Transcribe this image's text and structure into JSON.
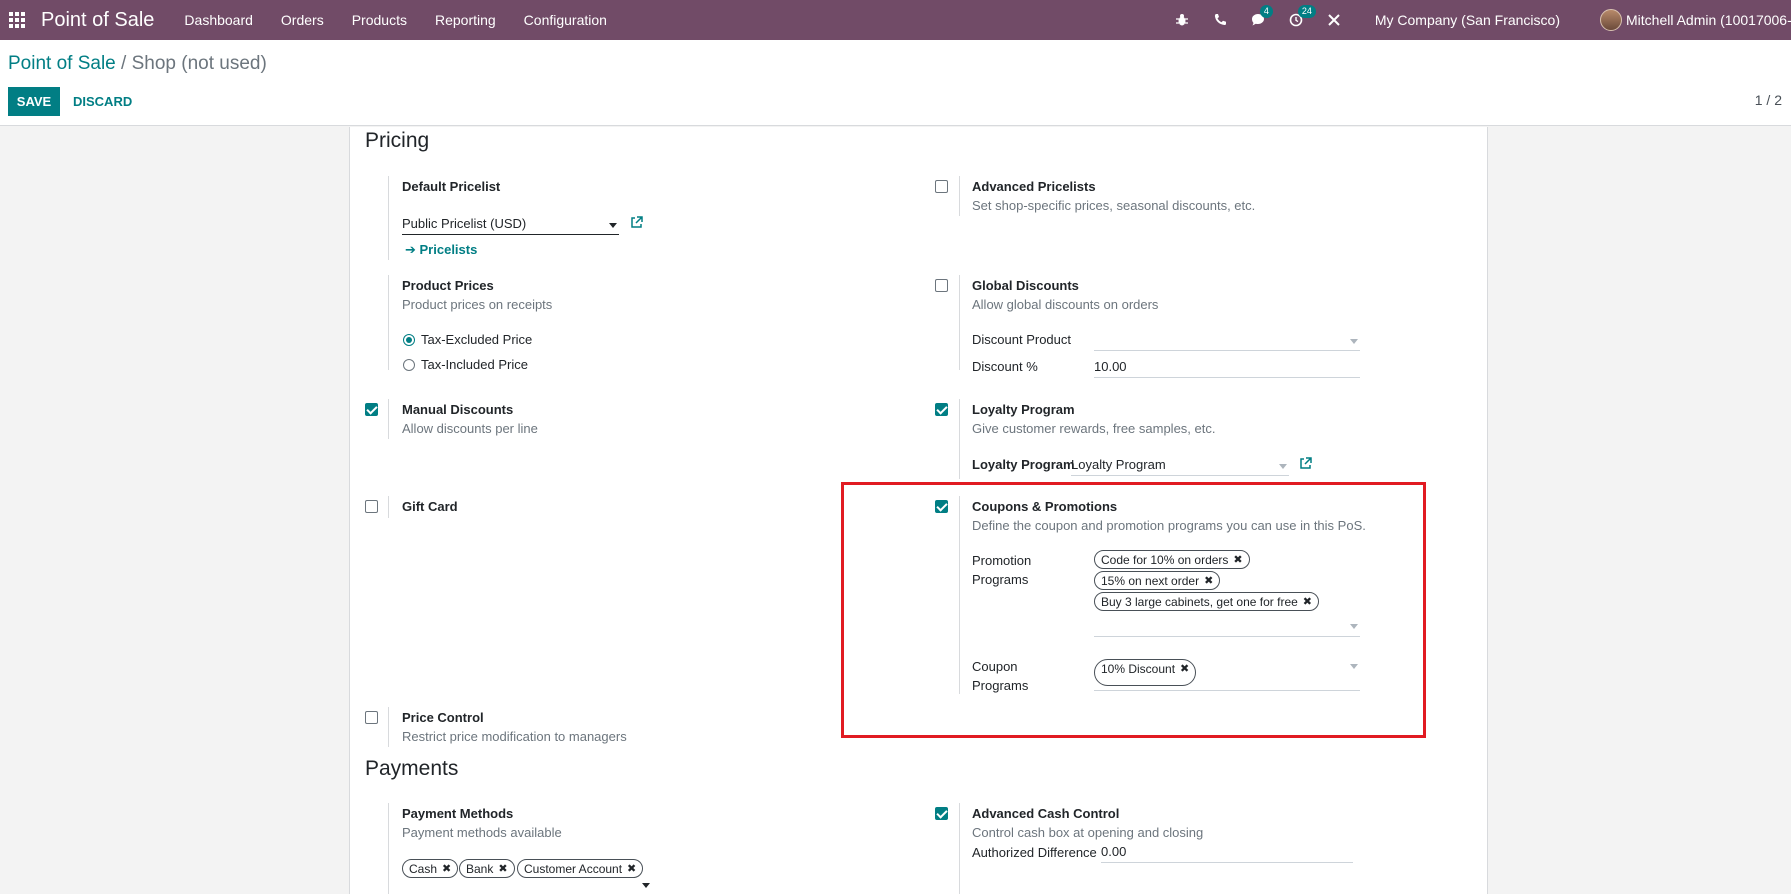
{
  "navbar": {
    "brand": "Point of Sale",
    "menu": [
      "Dashboard",
      "Orders",
      "Products",
      "Reporting",
      "Configuration"
    ],
    "messages_count": "4",
    "activities_count": "24",
    "company": "My Company (San Francisco)",
    "user": "Mitchell Admin (10017006-m"
  },
  "breadcrumb": {
    "parent": "Point of Sale",
    "separator": " / ",
    "current": "Shop (not used)"
  },
  "actions": {
    "save": "SAVE",
    "discard": "DISCARD"
  },
  "pager": "1 / 2",
  "pricing": {
    "title": "Pricing",
    "default_pricelist": {
      "title": "Default Pricelist",
      "value": "Public Pricelist (USD)",
      "link": "Pricelists"
    },
    "advanced_pricelists": {
      "title": "Advanced Pricelists",
      "desc": "Set shop-specific prices, seasonal discounts, etc.",
      "checked": false
    },
    "product_prices": {
      "title": "Product Prices",
      "desc": "Product prices on receipts",
      "options": [
        "Tax-Excluded Price",
        "Tax-Included Price"
      ],
      "selected": "Tax-Excluded Price"
    },
    "global_discounts": {
      "title": "Global Discounts",
      "desc": "Allow global discounts on orders",
      "checked": false,
      "discount_product_label": "Discount Product",
      "discount_product_value": "",
      "discount_pct_label": "Discount %",
      "discount_pct_value": "10.00"
    },
    "manual_discounts": {
      "title": "Manual Discounts",
      "desc": "Allow discounts per line",
      "checked": true
    },
    "loyalty_program": {
      "title": "Loyalty Program",
      "desc": "Give customer rewards, free samples, etc.",
      "checked": true,
      "field_label": "Loyalty Program",
      "field_value": "Loyalty Program"
    },
    "gift_card": {
      "title": "Gift Card",
      "checked": false
    },
    "coupons": {
      "title": "Coupons & Promotions",
      "desc": "Define the coupon and promotion programs you can use in this PoS.",
      "checked": true,
      "promotion_label_1": "Promotion",
      "promotion_label_2": "Programs",
      "promotion_tags": [
        "Code for 10% on orders",
        "15% on next order",
        "Buy 3 large cabinets, get one for free"
      ],
      "coupon_label_1": "Coupon",
      "coupon_label_2": "Programs",
      "coupon_tags": [
        "10% Discount"
      ]
    },
    "price_control": {
      "title": "Price Control",
      "desc": "Restrict price modification to managers",
      "checked": false
    }
  },
  "payments": {
    "title": "Payments",
    "payment_methods": {
      "title": "Payment Methods",
      "desc": "Payment methods available",
      "tags": [
        "Cash",
        "Bank",
        "Customer Account"
      ]
    },
    "cash_control": {
      "title": "Advanced Cash Control",
      "desc": "Control cash box at opening and closing",
      "checked": true,
      "field_label": "Authorized Difference",
      "field_value": "0.00"
    }
  },
  "colors": {
    "navbar": "#714B67",
    "accent": "#017e84",
    "highlight": "#e11b22"
  }
}
